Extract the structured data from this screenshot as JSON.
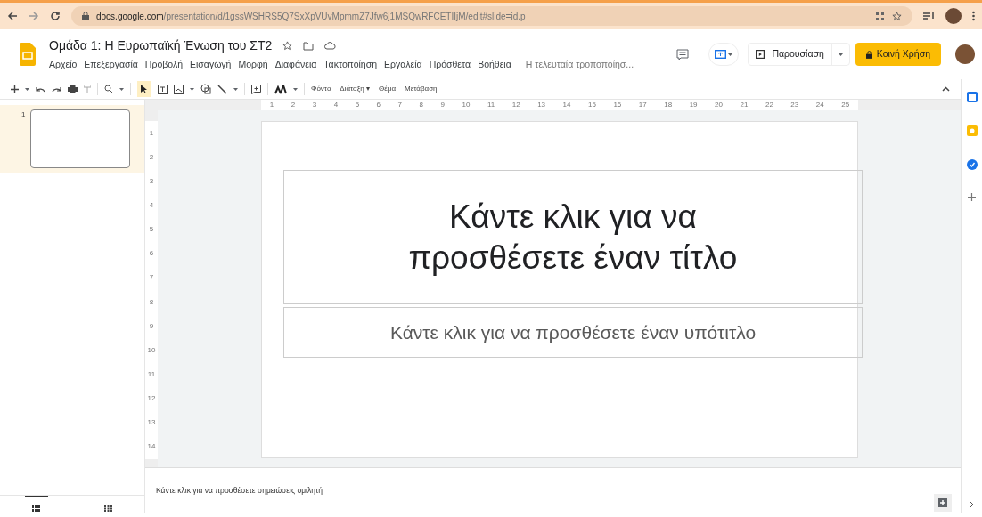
{
  "browser": {
    "url_host": "docs.google.com",
    "url_path": "/presentation/d/1gssWSHRS5Q7SxXpVUvMpmmZ7Jfw6j1MSQwRFCETIIjM/edit#slide=id.p"
  },
  "document": {
    "title": "Ομάδα 1: Η Ευρωπαϊκή Ένωση του ΣΤ2",
    "last_edit": "Η τελευταία τροποποίησ..."
  },
  "menu": [
    "Αρχείο",
    "Επεξεργασία",
    "Προβολή",
    "Εισαγωγή",
    "Μορφή",
    "Διαφάνεια",
    "Τακτοποίηση",
    "Εργαλεία",
    "Πρόσθετα",
    "Βοήθεια"
  ],
  "header_buttons": {
    "present": "Παρουσίαση",
    "share": "Κοινή Χρήση"
  },
  "toolbar_text": [
    "Φόντο",
    "Διάταξη ▾",
    "Θέμα",
    "Μετάβαση"
  ],
  "ruler_h": [
    "1",
    "2",
    "3",
    "4",
    "5",
    "6",
    "7",
    "8",
    "9",
    "10",
    "11",
    "12",
    "13",
    "14",
    "15",
    "16",
    "17",
    "18",
    "19",
    "20",
    "21",
    "22",
    "23",
    "24",
    "25"
  ],
  "ruler_v": [
    "1",
    "2",
    "3",
    "4",
    "5",
    "6",
    "7",
    "8",
    "9",
    "10",
    "11",
    "12",
    "13",
    "14"
  ],
  "slides": [
    {
      "number": "1",
      "selected": true
    }
  ],
  "slide": {
    "title_placeholder": "Κάντε κλικ για να προσθέσετε έναν τίτλο",
    "subtitle_placeholder": "Κάντε κλικ για να προσθέσετε έναν υπότιτλο"
  },
  "notes": {
    "placeholder": "Κάντε κλικ για να προσθέσετε σημειώσεις ομιλητή"
  },
  "view_tabs": [
    {
      "kind": "filmstrip",
      "selected": true
    },
    {
      "kind": "grid",
      "selected": false
    }
  ]
}
